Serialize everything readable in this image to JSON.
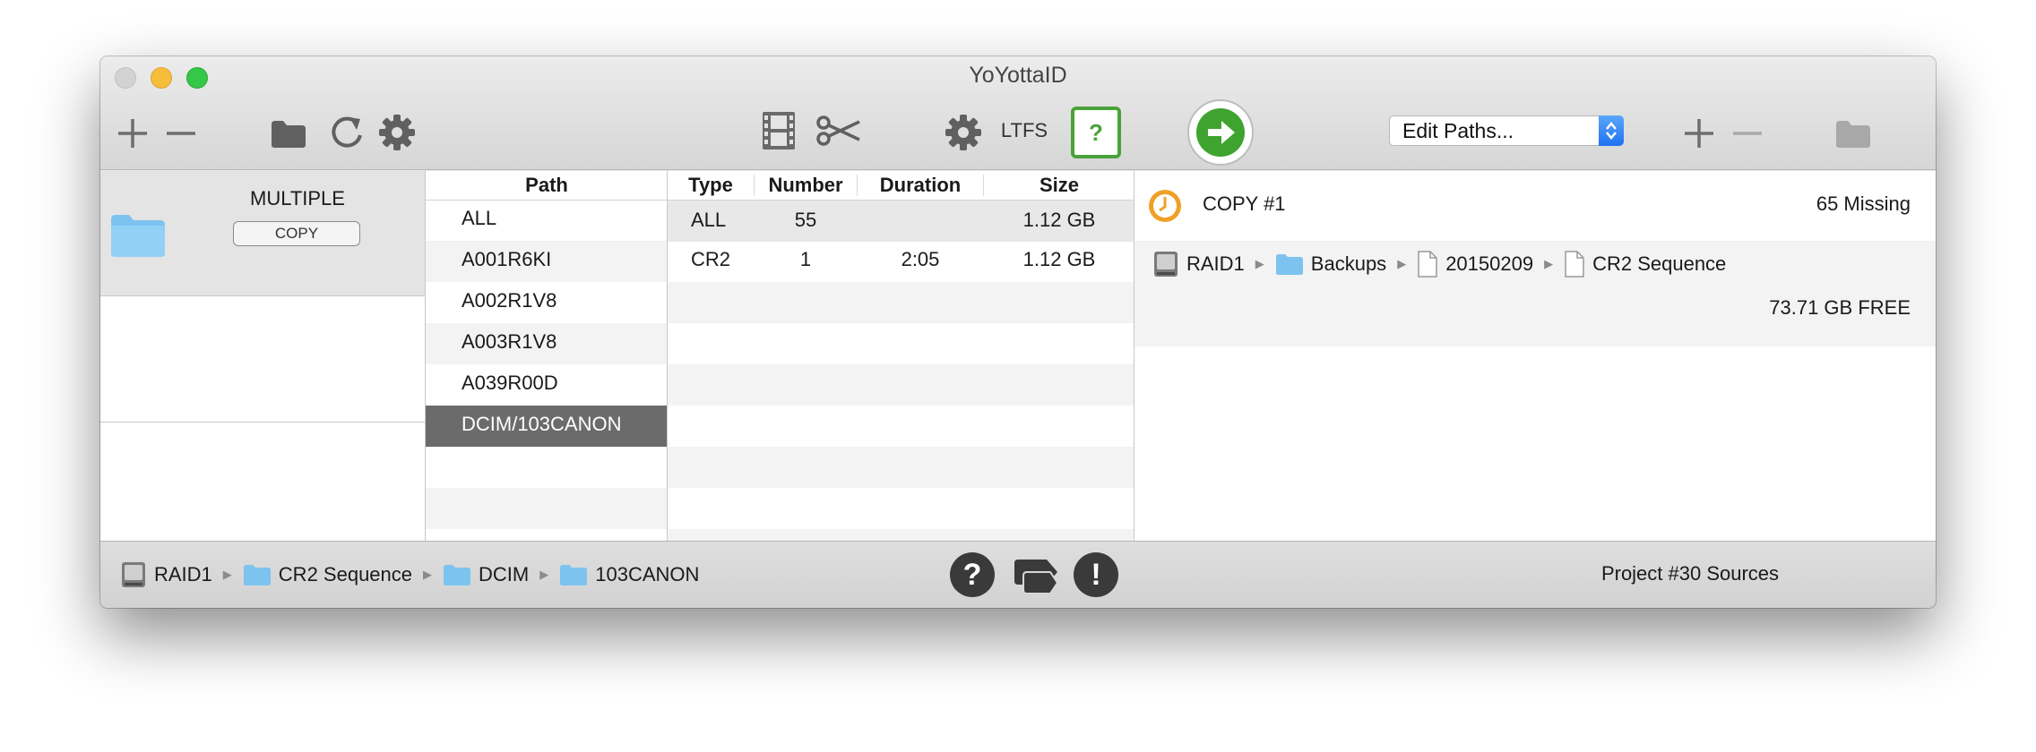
{
  "window": {
    "title": "YoYottaID"
  },
  "toolbar": {
    "ltfs_label": "LTFS",
    "help_label": "?",
    "edit_paths": {
      "selected": "Edit Paths..."
    }
  },
  "sources": {
    "selected": {
      "title": "MULTIPLE",
      "button": "COPY"
    }
  },
  "path_list": {
    "header": "Path",
    "items": [
      "ALL",
      "A001R6KI",
      "A002R1V8",
      "A003R1V8",
      "A039R00D",
      "DCIM/103CANON"
    ],
    "selected": "DCIM/103CANON"
  },
  "file_table": {
    "columns": [
      "Type",
      "Number",
      "Duration",
      "Size"
    ],
    "rows": [
      {
        "type": "ALL",
        "number": "55",
        "duration": "",
        "size": "1.12 GB"
      },
      {
        "type": "CR2",
        "number": "1",
        "duration": "2:05",
        "size": "1.12 GB"
      }
    ]
  },
  "destination": {
    "copy_label": "COPY #1",
    "missing": "65 Missing",
    "path": [
      "RAID1",
      "Backups",
      "20150209",
      "CR2 Sequence"
    ],
    "free": "73.71 GB FREE"
  },
  "statusbar": {
    "path": [
      "RAID1",
      "CR2 Sequence",
      "DCIM",
      "103CANON"
    ],
    "help_icon": "?",
    "alert_icon": "!",
    "project": "Project #30 Sources"
  },
  "colors": {
    "go_button": "#3fa32f",
    "help_accent": "#4aa23a",
    "folder": "#7cc3f0",
    "selection": "#6b6b6b"
  },
  "icons": [
    "add-icon",
    "remove-icon",
    "folder-icon",
    "refresh-icon",
    "gear-icon",
    "film-icon",
    "scissors-icon",
    "arrow-right-icon",
    "drive-icon",
    "document-icon",
    "clock-icon",
    "tag-icon"
  ]
}
